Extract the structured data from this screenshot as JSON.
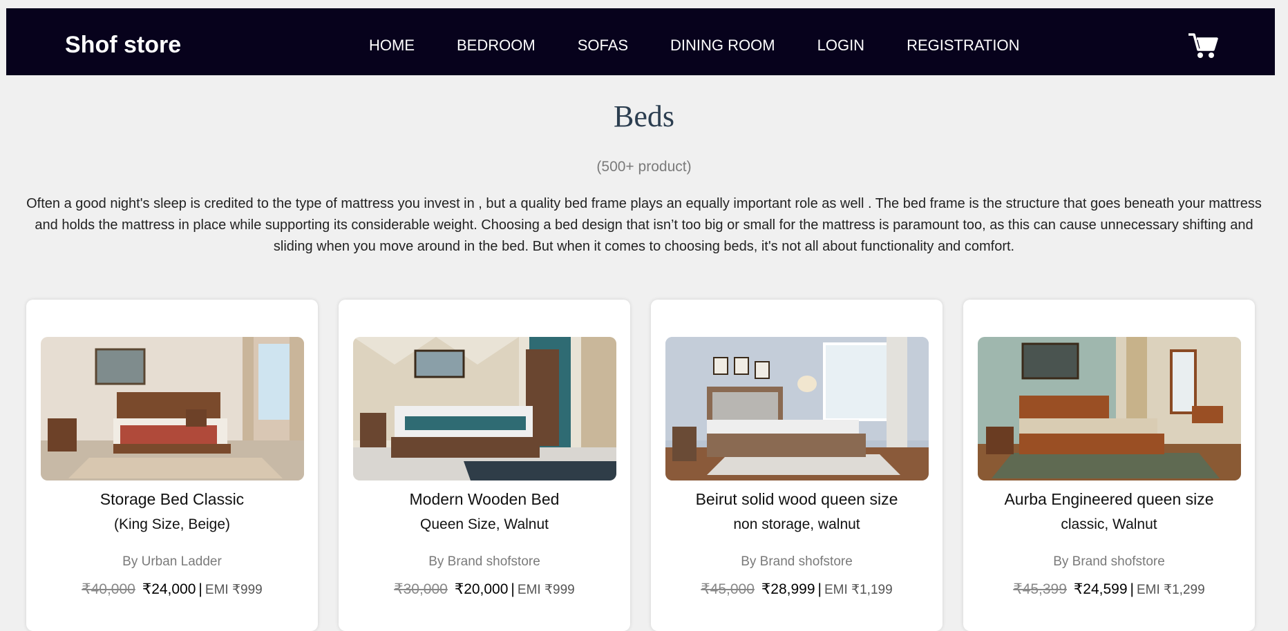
{
  "header": {
    "brand": "Shof store",
    "nav": [
      "HOME",
      "BEDROOM",
      "SOFAS",
      "DINING ROOM",
      "LOGIN",
      "REGISTRATION"
    ],
    "cart_icon": "cart-icon"
  },
  "page": {
    "title": "Beds",
    "count": "(500+ product)",
    "description": "Often a good night's sleep is credited to the type of mattress you invest in , but a quality bed frame plays an equally important role as well . The bed frame is the structure that goes beneath your mattress and holds the mattress in place while supporting its considerable weight. Choosing a bed design that isn’t too big or small for the mattress is paramount too, as this can cause unnecessary shifting and sliding when you move around in the bed. But when it comes to choosing beds, it's not all about functionality and comfort."
  },
  "products": [
    {
      "name": "Storage Bed Classic",
      "variant": "(King Size, Beige)",
      "brand": "By Urban Ladder",
      "old_price": "₹40,000",
      "price": "₹24,000",
      "separator": "|",
      "emi": "EMI ₹999"
    },
    {
      "name": "Modern Wooden Bed",
      "variant": "Queen Size, Walnut",
      "brand": "By Brand shofstore",
      "old_price": "₹30,000",
      "price": "₹20,000",
      "separator": "|",
      "emi": "EMI ₹999"
    },
    {
      "name": "Beirut solid wood queen size",
      "variant": "non storage, walnut",
      "brand": "By Brand shofstore",
      "old_price": "₹45,000",
      "price": "₹28,999",
      "separator": "|",
      "emi": "EMI ₹1,199"
    },
    {
      "name": "Aurba Engineered queen size",
      "variant": "classic, Walnut",
      "brand": "By Brand shofstore",
      "old_price": "₹45,399",
      "price": "₹24,599",
      "separator": "|",
      "emi": "EMI ₹1,299"
    }
  ],
  "colors": {
    "navbar_bg": "#07021c",
    "page_bg": "#f0f0f0",
    "title": "#2c3e50"
  }
}
